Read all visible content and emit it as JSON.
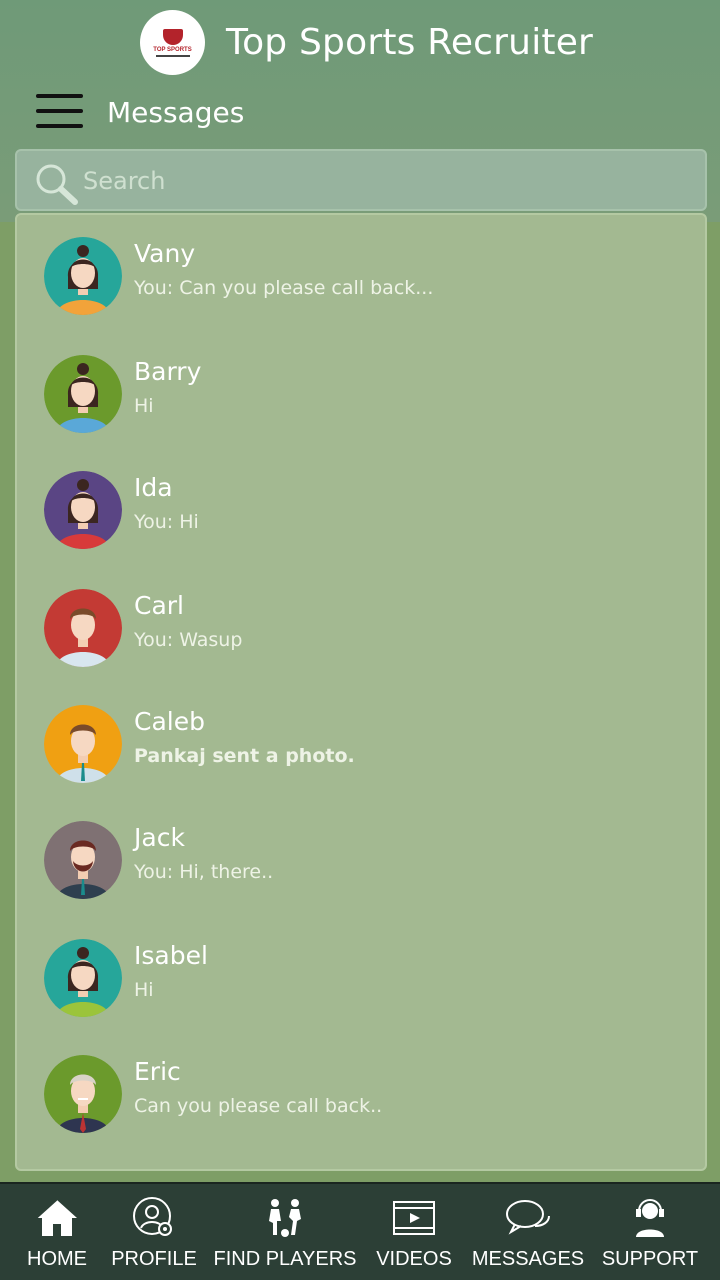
{
  "app": {
    "title": "Top Sports Recruiter",
    "logo_text": "TOP SPORTS",
    "page_title": "Messages"
  },
  "search": {
    "placeholder": "Search",
    "value": ""
  },
  "conversations": [
    {
      "name": "Vany",
      "preview": "You: Can you please call back...",
      "bold": false,
      "avatar_bg": "#26a69a",
      "gender": "f",
      "shirt": "#f2a33a"
    },
    {
      "name": "Barry",
      "preview": "Hi",
      "bold": false,
      "avatar_bg": "#6b9a2c",
      "gender": "f",
      "shirt": "#5aa8d8"
    },
    {
      "name": "Ida",
      "preview": "You: Hi",
      "bold": false,
      "avatar_bg": "#5a4584",
      "gender": "f",
      "shirt": "#d83a3a"
    },
    {
      "name": "Carl",
      "preview": "You: Wasup",
      "bold": false,
      "avatar_bg": "#c33a34",
      "gender": "m",
      "shirt": "#d8e6ef"
    },
    {
      "name": "Caleb",
      "preview": "Pankaj sent a photo.",
      "bold": true,
      "avatar_bg": "#f0a012",
      "gender": "m",
      "shirt": "#cfe0ea"
    },
    {
      "name": "Jack",
      "preview": "You: Hi, there..",
      "bold": false,
      "avatar_bg": "#7f7173",
      "gender": "m",
      "shirt": "#2e3f4f"
    },
    {
      "name": "Isabel",
      "preview": "Hi",
      "bold": false,
      "avatar_bg": "#26a69a",
      "gender": "f",
      "shirt": "#9bc43b"
    },
    {
      "name": "Eric",
      "preview": "Can you please call back..",
      "bold": false,
      "avatar_bg": "#6b9a2c",
      "gender": "old",
      "shirt": "#2e3550"
    }
  ],
  "tabs": [
    {
      "label": "HOME",
      "icon": "home-icon"
    },
    {
      "label": "PROFILE",
      "icon": "profile-settings-icon"
    },
    {
      "label": "FIND PLAYERS",
      "icon": "players-icon"
    },
    {
      "label": "VIDEOS",
      "icon": "video-icon"
    },
    {
      "label": "MESSAGES",
      "icon": "chat-bubbles-icon"
    },
    {
      "label": "SUPPORT",
      "icon": "headset-icon"
    }
  ],
  "colors": {
    "header": "#6f9a78",
    "list_bg": "#a3b991",
    "tabbar": "#2c3f36"
  }
}
